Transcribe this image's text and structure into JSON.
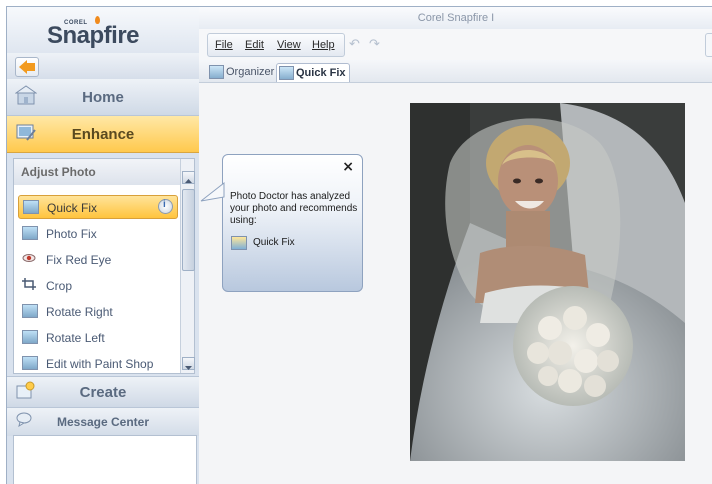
{
  "app": {
    "logo_brand": "COREL",
    "logo_text": "Snapfire",
    "window_title": "Corel Snapfire I"
  },
  "sidebar": {
    "nav_home": "Home",
    "nav_enhance": "Enhance",
    "panel_title": "Adjust Photo",
    "items": [
      {
        "label": "Quick Fix",
        "icon": "quick-fix-icon",
        "selected": true
      },
      {
        "label": "Photo Fix",
        "icon": "photo-fix-icon"
      },
      {
        "label": "Fix Red Eye",
        "icon": "red-eye-icon"
      },
      {
        "label": "Crop",
        "icon": "crop-icon"
      },
      {
        "label": "Rotate Right",
        "icon": "rotate-right-icon"
      },
      {
        "label": "Rotate Left",
        "icon": "rotate-left-icon"
      },
      {
        "label": "Edit with Paint Shop",
        "icon": "paint-shop-icon"
      }
    ],
    "nav_create": "Create",
    "nav_message": "Message Center"
  },
  "menubar": {
    "file": "File",
    "edit": "Edit",
    "view": "View",
    "help": "Help"
  },
  "tabs": [
    {
      "label": "Organizer",
      "active": false
    },
    {
      "label": "Quick Fix",
      "active": true
    }
  ],
  "popup": {
    "close": "×",
    "message": "Photo Doctor has analyzed your photo and recommends using:",
    "recommendation": "Quick Fix"
  },
  "colors": {
    "accent": "#ffc94d",
    "sidebar": "#d9e2ee"
  }
}
